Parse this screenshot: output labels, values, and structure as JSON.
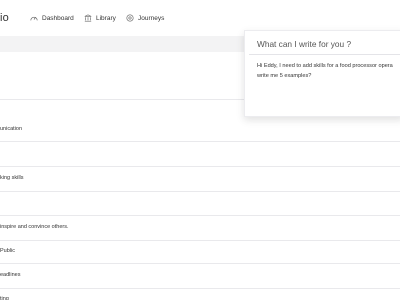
{
  "app": {
    "logo_fragment": "io"
  },
  "nav": {
    "items": [
      {
        "label": "Dashboard",
        "icon": "dashboard-icon"
      },
      {
        "label": "Library",
        "icon": "library-icon"
      },
      {
        "label": "Journeys",
        "icon": "journeys-icon"
      }
    ]
  },
  "list": {
    "rows": [
      {
        "label": "unication"
      },
      {
        "label": ""
      },
      {
        "label": "king skills"
      },
      {
        "label": ""
      },
      {
        "label": "inspire and convince others."
      },
      {
        "label": "Public"
      },
      {
        "label": "eadlines"
      },
      {
        "label": "ting"
      }
    ]
  },
  "popup": {
    "title": "What can I write for you ?",
    "message_line1": "Hi Eddy, I need to add skills for a food processor opera",
    "message_line2": "write me 5 examples?"
  },
  "colors": {
    "header_bar": "#f3f3f4",
    "divider": "#e9e9ec",
    "text": "#333333"
  }
}
